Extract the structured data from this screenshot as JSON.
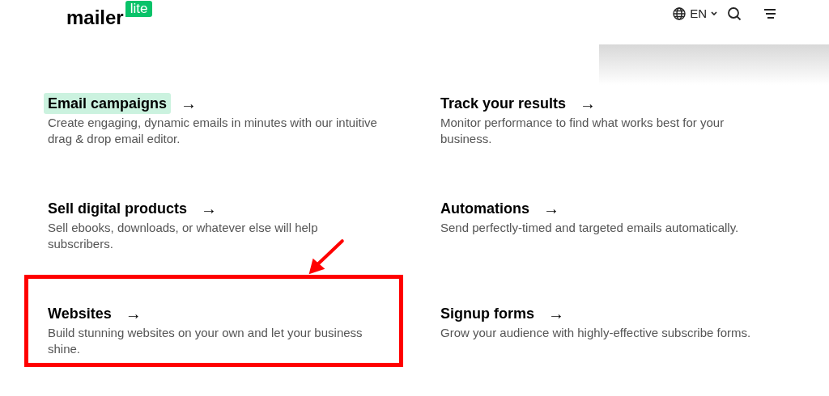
{
  "header": {
    "logo_word": "mailer",
    "logo_badge": "lite",
    "language": "EN"
  },
  "features": [
    {
      "title": "Email campaigns",
      "arrow": "→",
      "description": "Create engaging, dynamic emails in minutes with our intuitive drag & drop email editor.",
      "highlighted": true,
      "annotated": false
    },
    {
      "title": "Track your results",
      "arrow": "→",
      "description": "Monitor performance to find what works best for your business.",
      "highlighted": false,
      "annotated": false
    },
    {
      "title": "Sell digital products",
      "arrow": "→",
      "description": "Sell ebooks, downloads, or whatever else will help subscribers.",
      "highlighted": false,
      "annotated": false
    },
    {
      "title": "Automations",
      "arrow": "→",
      "description": "Send perfectly-timed and targeted emails automatically.",
      "highlighted": false,
      "annotated": false
    },
    {
      "title": "Websites",
      "arrow": "→",
      "description": "Build stunning websites on your own and let your business shine.",
      "highlighted": false,
      "annotated": true
    },
    {
      "title": "Signup forms",
      "arrow": "→",
      "description": "Grow your audience with highly-effective subscribe forms.",
      "highlighted": false,
      "annotated": false
    }
  ]
}
